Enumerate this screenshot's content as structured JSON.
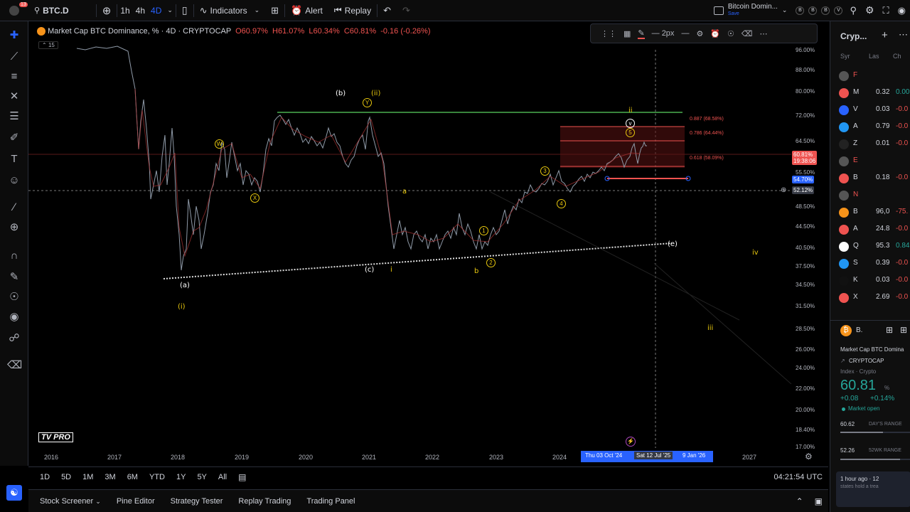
{
  "topbar": {
    "symbol": "BTC.D",
    "intervals": [
      "1h",
      "4h",
      "4D"
    ],
    "indicators_label": "Indicators",
    "alert_label": "Alert",
    "replay_label": "Replay",
    "layout_title": "Bitcoin Domin...",
    "layout_sub": "Save",
    "notif_count": "13"
  },
  "legend": {
    "title": "Market Cap BTC Dominance, %  · 4D · CRYPTOCAP",
    "open": "O60.97%",
    "high": "H61.07%",
    "low": "L60.34%",
    "close": "C60.81%",
    "change": "-0.16 (-0.26%)",
    "badge": "15"
  },
  "drawbar": {
    "width_label": "2px"
  },
  "price_axis": [
    "96.00%",
    "88.00%",
    "80.00%",
    "72.00%",
    "64.50%",
    "55.50%",
    "48.50%",
    "44.50%",
    "40.50%",
    "37.50%",
    "34.50%",
    "31.50%",
    "28.50%",
    "26.00%",
    "24.00%",
    "22.00%",
    "20.00%",
    "18.40%",
    "17.00%"
  ],
  "price_tags": {
    "current": "60.81%",
    "current_time": "19:38:06",
    "blue1": "54.70%",
    "blue2": "52.12%"
  },
  "fib": {
    "f887": "0.887 (68.58%)",
    "f786": "0.786 (64.44%)",
    "f618": "0.618 (58.09%)"
  },
  "time_axis": [
    "2016",
    "2017",
    "2018",
    "2019",
    "2020",
    "2021",
    "2022",
    "2023",
    "2024",
    "2027"
  ],
  "time_range": {
    "start": "Thu 03 Oct '24",
    "mid": "Sat 12 Jul '25",
    "end": "9 Jan '26"
  },
  "waves": {
    "a": "(a)",
    "b": "(b)",
    "c": "(c)",
    "e": "(e)",
    "i_roman": "(i)",
    "ii_roman": "(ii)",
    "iii": "iii",
    "iv": "iv",
    "ii": "ii",
    "w_a": "a",
    "w_b": "b",
    "w_i": "i",
    "x": "X",
    "y": "Y",
    "w": "W",
    "n1": "1",
    "n2": "2",
    "n3": "3",
    "n4": "4",
    "n5": "5",
    "v": "v"
  },
  "logo": "TV PRO",
  "bottom_ranges": [
    "1D",
    "5D",
    "1M",
    "3M",
    "6M",
    "YTD",
    "1Y",
    "5Y",
    "All"
  ],
  "clock": "04:21:54 UTC",
  "bottom_tabs": [
    "Stock Screener",
    "Pine Editor",
    "Strategy Tester",
    "Replay Trading",
    "Trading Panel"
  ],
  "watchlist": {
    "title": "Cryp...",
    "cols": [
      "Syr",
      "Las",
      "Ch"
    ],
    "rows": [
      {
        "sym": "F",
        "val": "",
        "chg": "",
        "color": "#555",
        "chg_class": "red"
      },
      {
        "sym": "M",
        "val": "0.32",
        "chg": "0.00",
        "color": "#ef5350",
        "chg_class": "green"
      },
      {
        "sym": "V",
        "val": "0.03",
        "chg": "-0.0",
        "color": "#2962ff",
        "chg_class": "red"
      },
      {
        "sym": "A",
        "val": "0.79",
        "chg": "-0.0",
        "color": "#2196f3",
        "chg_class": "red"
      },
      {
        "sym": "Z",
        "val": "0.01",
        "chg": "-0.0",
        "color": "#222",
        "chg_class": "red"
      },
      {
        "sym": "E",
        "val": "",
        "chg": "",
        "color": "#555",
        "chg_class": "red"
      },
      {
        "sym": "B",
        "val": "0.18",
        "chg": "-0.0",
        "color": "#ef5350",
        "chg_class": "red"
      },
      {
        "sym": "N",
        "val": "",
        "chg": "",
        "color": "#555",
        "chg_class": "red"
      },
      {
        "sym": "B",
        "val": "96,0",
        "chg": "-75.",
        "color": "#f7931a",
        "chg_class": "red"
      },
      {
        "sym": "A",
        "val": "24.8",
        "chg": "-0.0",
        "color": "#ef5350",
        "chg_class": "red"
      },
      {
        "sym": "Q",
        "val": "95.3",
        "chg": "0.84",
        "color": "#fff",
        "chg_class": "green"
      },
      {
        "sym": "S",
        "val": "0.39",
        "chg": "-0.0",
        "color": "#2196f3",
        "chg_class": "red"
      },
      {
        "sym": "K",
        "val": "0.03",
        "chg": "-0.0",
        "color": "#111",
        "chg_class": "red"
      },
      {
        "sym": "X",
        "val": "2.69",
        "chg": "-0.0",
        "color": "#ef5350",
        "chg_class": "red"
      }
    ]
  },
  "detail": {
    "sym": "B.",
    "name": "Market Cap BTC Domina",
    "exchange": "CRYPTOCAP",
    "type": "Index · Crypto",
    "price": "60.81",
    "unit": "%",
    "change": "+0.08",
    "change_pct": "+0.14%",
    "status": "Market open",
    "day_low": "60.62",
    "day_range_label": "DAY'S RANGE",
    "wk_low": "52.26",
    "wk_range_label": "52WK RANGE",
    "news_time": "1 hour ago · 12",
    "news_text": "states hold a trea"
  }
}
